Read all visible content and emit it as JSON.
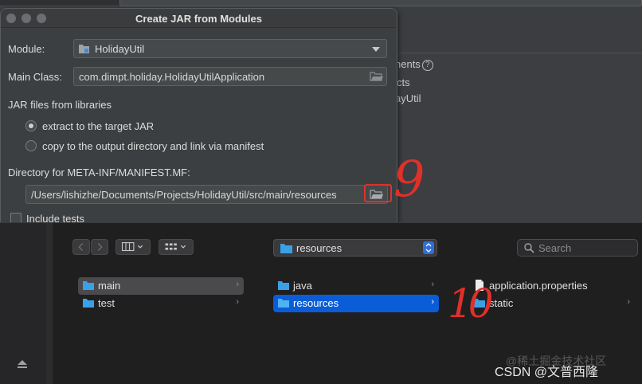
{
  "dialog": {
    "title": "Create JAR from Modules",
    "module_label": "Module:",
    "module_value": "HolidayUtil",
    "main_class_label": "Main Class:",
    "main_class_value": "com.dimpt.holiday.HolidayUtilApplication",
    "jar_files_label": "JAR files from libraries",
    "radio_extract": "extract to the target JAR",
    "radio_copy": "copy to the output directory and link via manifest",
    "manifest_dir_label": "Directory for META-INF/MANIFEST.MF:",
    "manifest_dir_value": "/Users/lishizhe/Documents/Projects/HolidayUtil/src/main/resources",
    "include_tests": "Include tests"
  },
  "background": {
    "text1": "nents",
    "text2": "cts",
    "text3": "ayUtil",
    "help_glyph": "?"
  },
  "annotations": {
    "step9": "9",
    "step10": "10",
    "color": "#e0302a"
  },
  "chooser": {
    "path_popup": "resources",
    "search_placeholder": "Search",
    "col1": [
      {
        "label": "main"
      },
      {
        "label": "test"
      }
    ],
    "col2": [
      {
        "label": "java"
      },
      {
        "label": "resources"
      }
    ],
    "col3": [
      {
        "label": "application.properties"
      },
      {
        "label": "static"
      }
    ]
  },
  "watermark": "CSDN @文普西隆",
  "watermark_faint": "@稀土掘金技术社区",
  "colors": {
    "accent": "#0a5dd6",
    "folder": "#3aa0e8"
  }
}
